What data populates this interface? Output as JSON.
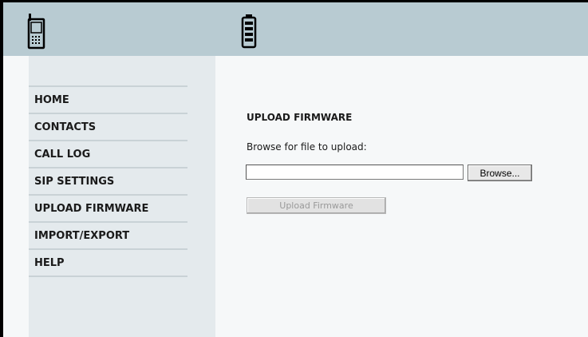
{
  "header": {
    "icons": [
      "handset-icon",
      "battery-icon"
    ]
  },
  "sidebar": {
    "items": [
      {
        "label": "HOME",
        "icon": ""
      },
      {
        "label": "CONTACTS"
      },
      {
        "label": "CALL LOG"
      },
      {
        "label": "SIP SETTINGS"
      },
      {
        "label": "UPLOAD FIRMWARE"
      },
      {
        "label": "IMPORT/EXPORT"
      },
      {
        "label": "HELP"
      }
    ]
  },
  "main": {
    "title": "UPLOAD FIRMWARE",
    "browse_label": "Browse for file to upload:",
    "file_value": "",
    "browse_button": "Browse...",
    "upload_button": "Upload Firmware"
  },
  "colors": {
    "header_bg": "#b8cbd2",
    "sidebar_bg": "#e4eaed",
    "content_bg": "#f6f8f9",
    "divider": "#c9d2d6"
  }
}
